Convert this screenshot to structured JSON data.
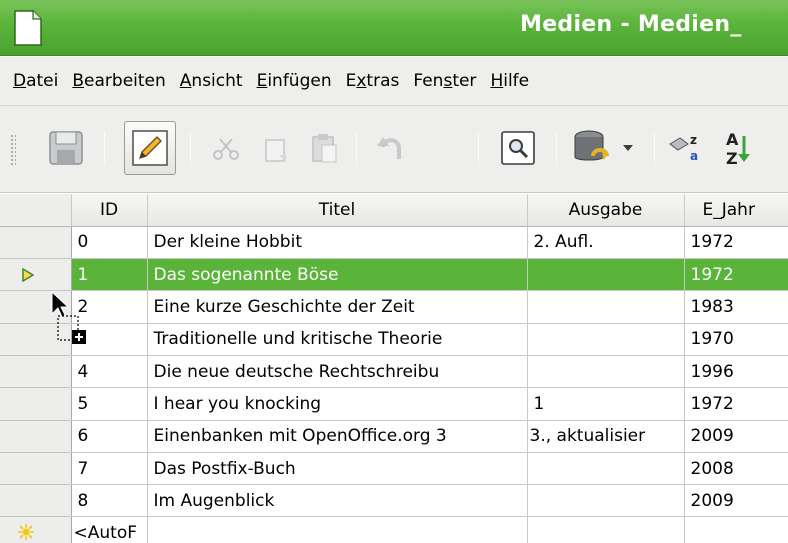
{
  "window": {
    "title": "Medien - Medien_",
    "title_color": "#5ab43a"
  },
  "menu": [
    {
      "pre": "",
      "acc": "D",
      "post": "atei"
    },
    {
      "pre": "",
      "acc": "B",
      "post": "earbeiten"
    },
    {
      "pre": "",
      "acc": "A",
      "post": "nsicht"
    },
    {
      "pre": "",
      "acc": "E",
      "post": "infügen"
    },
    {
      "pre": "E",
      "acc": "x",
      "post": "tras"
    },
    {
      "pre": "Fen",
      "acc": "s",
      "post": "ter"
    },
    {
      "pre": "",
      "acc": "H",
      "post": "ilfe"
    }
  ],
  "toolbar": {
    "icons": [
      "save-icon",
      "edit-mode-icon",
      "cut-icon",
      "copy-icon",
      "paste-icon",
      "undo-icon",
      "find-record-icon",
      "data-source-icon",
      "dropdown-arrow-icon",
      "sort-icon",
      "sort-ascending-icon"
    ],
    "sort_label": "A Z"
  },
  "table": {
    "columns": [
      "ID",
      "Titel",
      "Ausgabe",
      "E_Jahr"
    ],
    "rows": [
      {
        "id": "0",
        "titel": "Der kleine Hobbit",
        "ausgabe": "2. Aufl.",
        "jahr": "1972"
      },
      {
        "id": "1",
        "titel": "Das sogenannte Böse",
        "ausgabe": "",
        "jahr": "1972"
      },
      {
        "id": "2",
        "titel": "Eine kurze Geschichte der Zeit",
        "ausgabe": "",
        "jahr": "1983"
      },
      {
        "id": "",
        "titel": "Traditionelle und kritische Theorie",
        "ausgabe": "",
        "jahr": "1970"
      },
      {
        "id": "4",
        "titel": "Die neue deutsche Rechtschreibu",
        "ausgabe": "",
        "jahr": "1996"
      },
      {
        "id": "5",
        "titel": "I hear you knocking",
        "ausgabe": "1",
        "jahr": "1972"
      },
      {
        "id": "6",
        "titel": "Einenbanken mit OpenOffice.org 3",
        "ausgabe": "3., aktualisier",
        "jahr": "2009"
      },
      {
        "id": "7",
        "titel": "Das Postfix-Buch",
        "ausgabe": "",
        "jahr": "2008"
      },
      {
        "id": "8",
        "titel": "Im Augenblick",
        "ausgabe": "",
        "jahr": "2009"
      }
    ],
    "selected_row": 1,
    "new_row": {
      "id": "<AutoF",
      "titel": "",
      "ausgabe": "",
      "jahr": ""
    },
    "selection_color": "#5ab43a"
  }
}
